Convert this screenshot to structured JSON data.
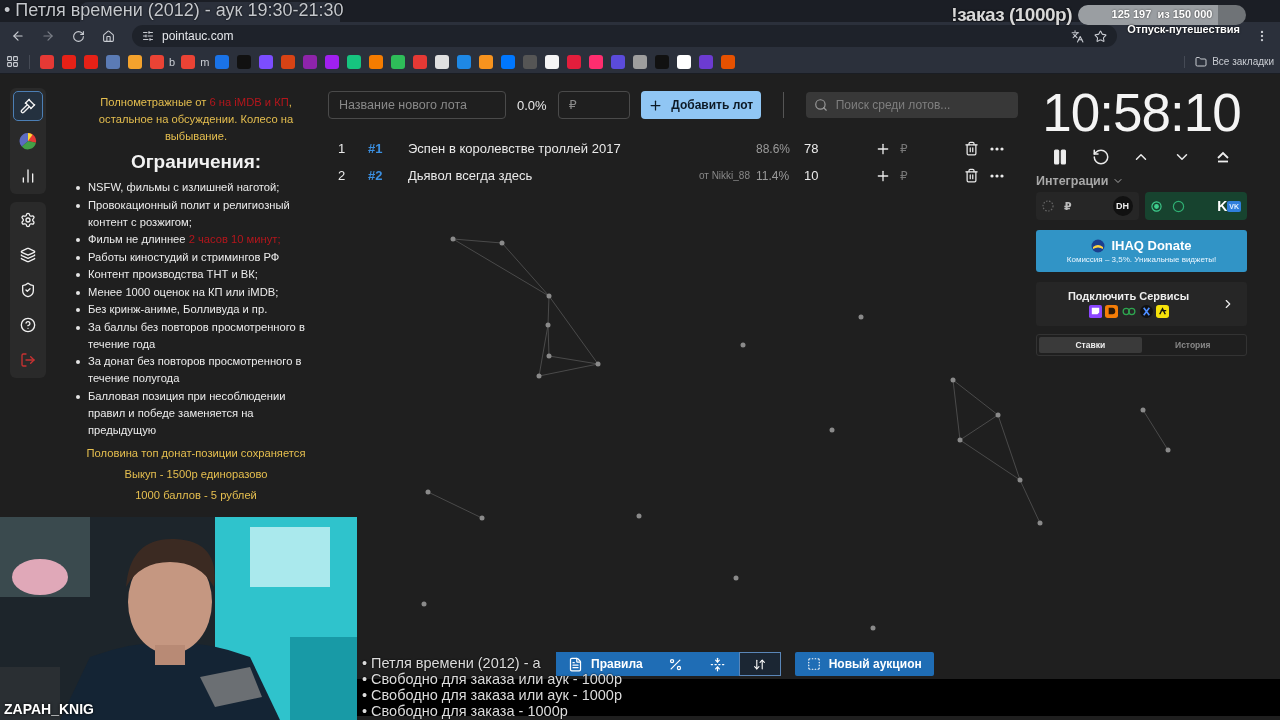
{
  "stream_overlay": {
    "title": "• Петля времени (2012) - аук 19:30-21:30",
    "order_label": "!заказ (1000р)",
    "goal": {
      "reading": "125 197  из 150 000",
      "level": 0.835,
      "caption": "Отпуск-путешествия"
    },
    "webcam": {
      "kind": "picture",
      "caption": "ZAPAH_KNIG"
    },
    "queue": [
      "• Петля времени (2012) - а",
      "• Свободно для заказа или аук - 1000р",
      "• Свободно для заказа или аук - 1000р",
      "• Свободно для заказа - 1000р"
    ]
  },
  "browser": {
    "url": "pointauc.com",
    "all_bookmarks": "Все закладки",
    "bookmarks": [
      {
        "color": "#e53935"
      },
      {
        "color": "#e62117"
      },
      {
        "color": "#e62117"
      },
      {
        "color": "#5b7bb5"
      },
      {
        "color": "#f4a22d"
      },
      {
        "color": "#ea4335",
        "label": "b"
      },
      {
        "color": "#ea4335",
        "label": "m"
      },
      {
        "color": "#1a73e8"
      },
      {
        "color": "#111111"
      },
      {
        "color": "#7c4dff"
      },
      {
        "color": "#d84315"
      },
      {
        "color": "#8e24aa"
      },
      {
        "color": "#a020f0"
      },
      {
        "color": "#16c47f"
      },
      {
        "color": "#f57c00"
      },
      {
        "color": "#2ebd59"
      },
      {
        "color": "#e53935"
      },
      {
        "color": "#e0e0e0"
      },
      {
        "color": "#1e88e5"
      },
      {
        "color": "#f7931e"
      },
      {
        "color": "#0077ff"
      },
      {
        "color": "#555555"
      },
      {
        "color": "#f5f5f5"
      },
      {
        "color": "#e31e3c"
      },
      {
        "color": "#ff2d6f"
      },
      {
        "color": "#5b4bdb"
      },
      {
        "color": "#9e9e9e"
      },
      {
        "color": "#111111"
      },
      {
        "color": "#ffffff"
      },
      {
        "color": "#6c3bd1"
      },
      {
        "color": "#e65100"
      }
    ]
  },
  "sidebar": {
    "groups": [
      [
        {
          "kind": "gavel",
          "selected": true
        },
        {
          "kind": "wheel",
          "selected": false
        },
        {
          "kind": "stats",
          "selected": false
        }
      ],
      [
        {
          "kind": "settings",
          "selected": false
        },
        {
          "kind": "layers",
          "selected": false
        },
        {
          "kind": "shield",
          "selected": false
        },
        {
          "kind": "help",
          "selected": false
        },
        {
          "kind": "logout",
          "selected": false
        }
      ]
    ]
  },
  "rules": {
    "intro": [
      {
        "text": "Полнометражные от ",
        "kind": "normal"
      },
      {
        "text": "6 на iMDB и КП",
        "kind": "warning"
      },
      {
        "text": ", остальное на обсуждении. Колесо на выбывание.",
        "kind": "normal"
      }
    ],
    "heading": "Ограничения:",
    "items": [
      {
        "segments": [
          {
            "text": "NSFW, фильмы с излишней наготой;",
            "kind": "normal"
          }
        ]
      },
      {
        "segments": [
          {
            "text": "Провокационный полит и религиозный контент с розжигом;",
            "kind": "normal"
          }
        ]
      },
      {
        "segments": [
          {
            "text": "Фильм не длиннее ",
            "kind": "normal"
          },
          {
            "text": "2 часов 10 минут;",
            "kind": "warning"
          }
        ]
      },
      {
        "segments": [
          {
            "text": "Работы киностудий и стримингов РФ",
            "kind": "normal"
          }
        ]
      },
      {
        "segments": [
          {
            "text": "Контент производства ТНТ и ВК;",
            "kind": "normal"
          }
        ]
      },
      {
        "segments": [
          {
            "text": "Менее 1000 оценок на КП или iMDB;",
            "kind": "normal"
          }
        ]
      },
      {
        "segments": [
          {
            "text": "Без кринж-аниме, Болливуда и пр.",
            "kind": "normal"
          }
        ]
      },
      {
        "segments": [
          {
            "text": "За баллы без повторов просмотренного в течение года",
            "kind": "normal"
          }
        ]
      },
      {
        "segments": [
          {
            "text": "За донат без повторов просмотренного в течение полугода",
            "kind": "normal"
          }
        ]
      },
      {
        "segments": [
          {
            "text": "Балловая позиция при несоблюдении правил и победе заменяется на предыдущую",
            "kind": "normal"
          }
        ]
      }
    ],
    "footer": [
      "Половина топ донат-позиции сохраняется",
      "Выкуп - 1500р единоразово",
      "1000 баллов - 5 рублей"
    ]
  },
  "lot_toolbar": {
    "name_placeholder": "Название нового лота",
    "percent": "0.0%",
    "amount_placeholder": "₽",
    "add_button": "Добавить лот",
    "search_placeholder": "Поиск среди лотов..."
  },
  "lots": [
    {
      "index": "1",
      "id": "#1",
      "name": "Эспен в королевстве троллей 2017",
      "percent": "88.6%",
      "amount": "78",
      "currency": "₽"
    },
    {
      "index": "2",
      "id": "#2",
      "name": "Дьявол всегда здесь",
      "author": "от Nikki_88",
      "percent": "11.4%",
      "amount": "10",
      "currency": "₽"
    }
  ],
  "timer": "10:58:10",
  "integrations": {
    "label": "Интеграции",
    "items": [
      {
        "connected": false,
        "currency": "₽",
        "logo": "DH"
      },
      {
        "connected": true,
        "logo": "K",
        "badge": "VK"
      }
    ]
  },
  "donate": {
    "title": "IHAQ Donate",
    "subtitle": "Комиссия – 3,5%. Уникальные виджеты!"
  },
  "connect": {
    "title": "Подключить Сервисы"
  },
  "history_tabs": [
    {
      "label": "Ставки",
      "selected": true
    },
    {
      "label": "История",
      "selected": false
    }
  ],
  "bottom_toolbar": {
    "tools": [
      {
        "kind": "rules",
        "label": "Правила",
        "selected": false
      },
      {
        "kind": "percent",
        "selected": false
      },
      {
        "kind": "fold",
        "selected": false
      },
      {
        "kind": "sort",
        "selected": true
      }
    ],
    "new_auction": "Новый аукцион"
  }
}
